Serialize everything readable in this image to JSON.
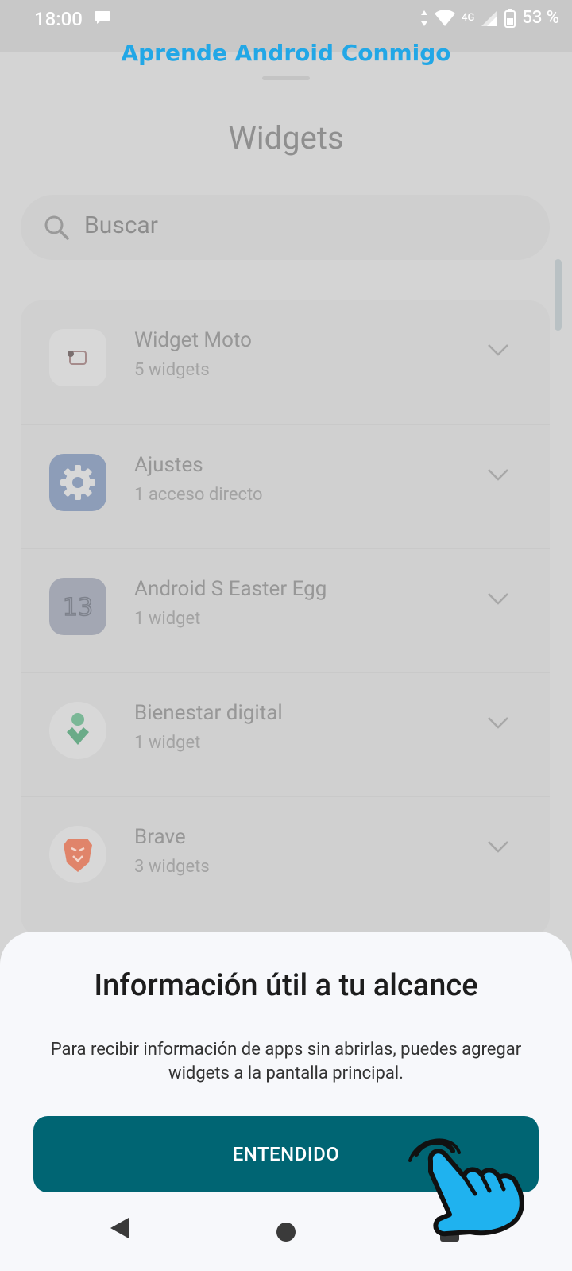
{
  "status": {
    "time": "18:00",
    "network": "4G",
    "battery": "53 %"
  },
  "watermark": "Aprende Android Conmigo",
  "picker": {
    "title": "Widgets",
    "search_placeholder": "Buscar",
    "items": [
      {
        "name": "Widget Moto",
        "sub": "5 widgets",
        "icon": "moto-widget-icon"
      },
      {
        "name": "Ajustes",
        "sub": "1 acceso directo",
        "icon": "settings-gear-icon"
      },
      {
        "name": "Android S Easter Egg",
        "sub": "1 widget",
        "icon": "android-13-icon"
      },
      {
        "name": "Bienestar digital",
        "sub": "1 widget",
        "icon": "digital-wellbeing-icon"
      },
      {
        "name": "Brave",
        "sub": "3 widgets",
        "icon": "brave-lion-icon"
      }
    ]
  },
  "dialog": {
    "title": "Información útil a tu alcance",
    "body": "Para recibir información de apps sin abrirlas, puedes agregar widgets a la pantalla principal.",
    "button": "ENTENDIDO"
  },
  "colors": {
    "accent": "#006573",
    "watermark": "#22a7e6",
    "hand": "#1fb2ef"
  }
}
